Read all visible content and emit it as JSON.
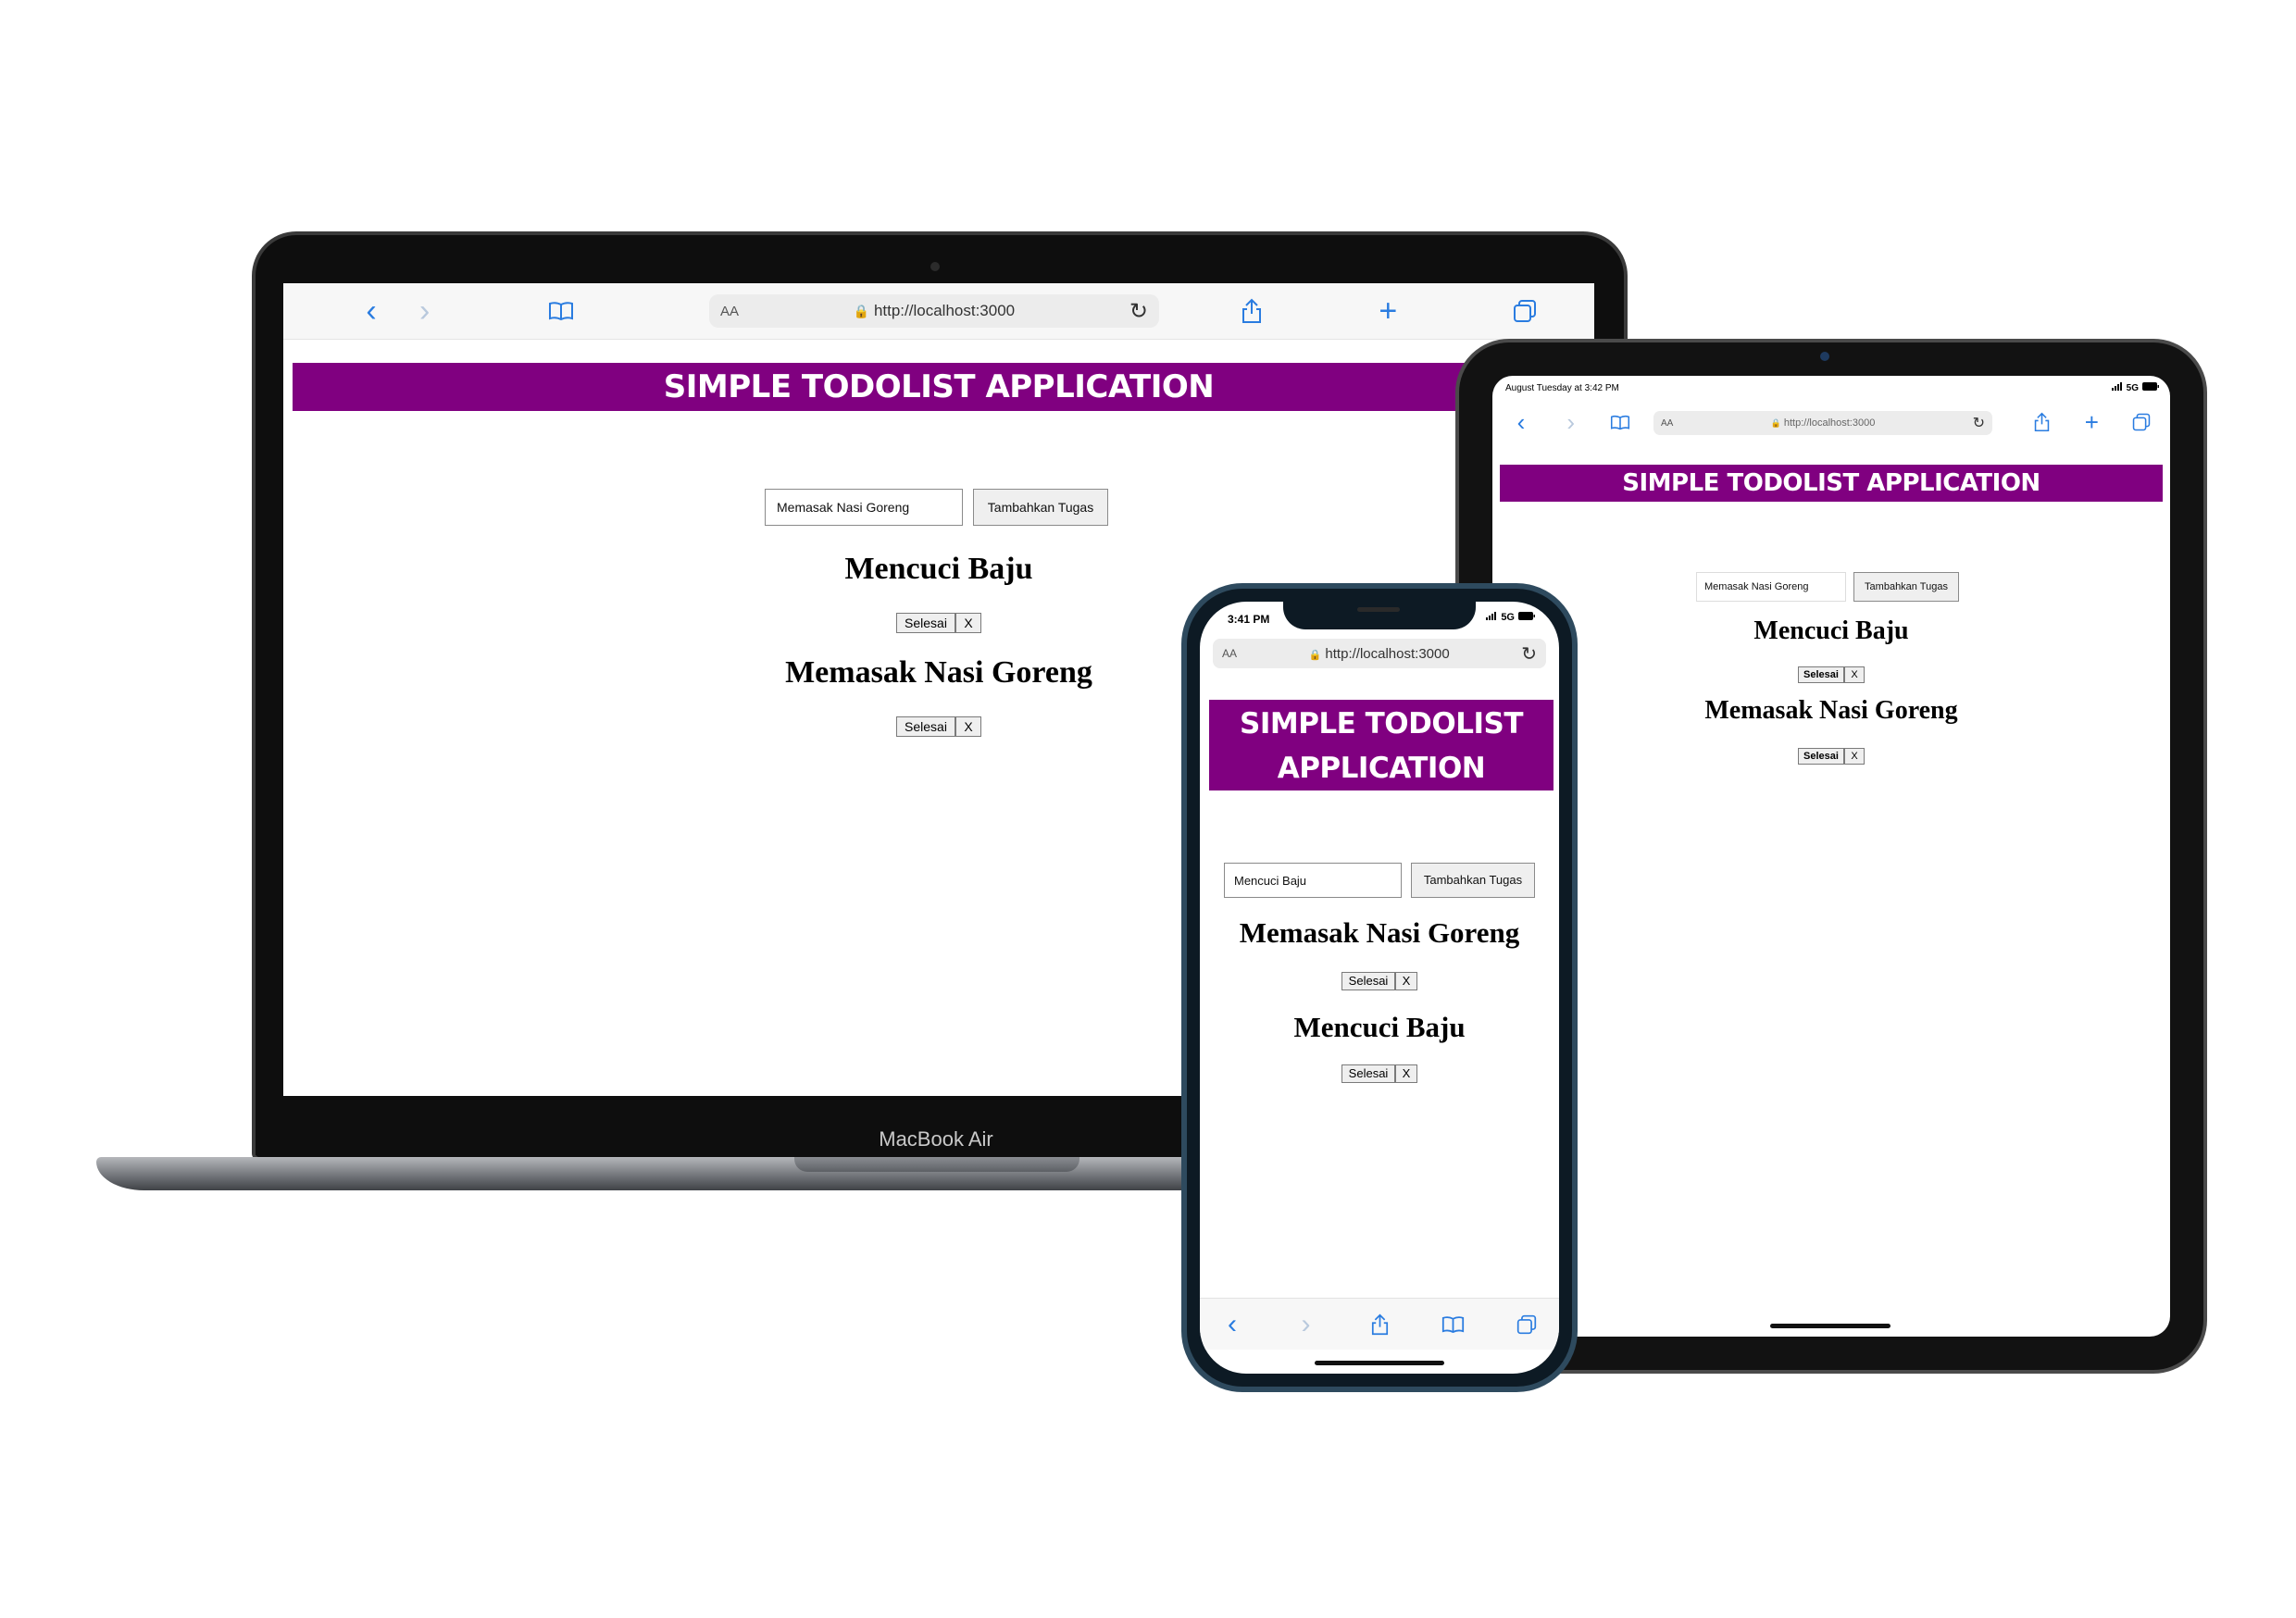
{
  "browser": {
    "url": "http://localhost:3000",
    "reader_label": "AA"
  },
  "app": {
    "title": "SIMPLE TODOLIST APPLICATION",
    "title_line1": "SIMPLE TODOLIST",
    "title_line2": "APPLICATION",
    "add_button_label": "Tambahkan Tugas",
    "done_button_label": "Selesai",
    "delete_button_label": "X",
    "accent_color": "#800080"
  },
  "laptop": {
    "brand_label": "MacBook Air",
    "input_value": "Memasak Nasi Goreng",
    "tasks": [
      {
        "title": "Mencuci Baju"
      },
      {
        "title": "Memasak Nasi Goreng"
      }
    ]
  },
  "tablet": {
    "status_time": "August Tuesday at 3:42 PM",
    "status_signal": "5G",
    "input_value": "Memasak Nasi Goreng",
    "tasks": [
      {
        "title": "Mencuci Baju"
      },
      {
        "title": "Memasak Nasi Goreng"
      }
    ]
  },
  "phone": {
    "status_time": "3:41 PM",
    "status_signal": "5G",
    "input_value": "Mencuci Baju",
    "tasks": [
      {
        "title": "Memasak Nasi Goreng"
      },
      {
        "title": "Mencuci Baju"
      }
    ]
  },
  "icons": [
    "back-icon",
    "forward-icon",
    "bookmarks-icon",
    "lock-icon",
    "reload-icon",
    "share-icon",
    "new-tab-icon",
    "tabs-icon",
    "battery-icon",
    "signal-icon"
  ]
}
